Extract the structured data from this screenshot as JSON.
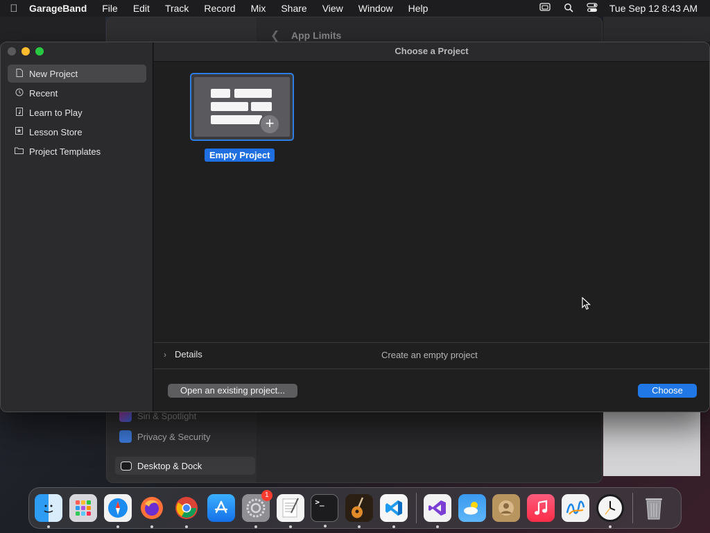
{
  "menubar": {
    "app_name": "GarageBand",
    "menus": [
      "File",
      "Edit",
      "Track",
      "Record",
      "Mix",
      "Share",
      "View",
      "Window",
      "Help"
    ],
    "datetime": "Tue Sep 12  8:43 AM",
    "status_icons": [
      "screen-mirroring-icon",
      "spotlight-search-icon",
      "control-center-icon"
    ]
  },
  "background_window": {
    "title": "App Limits",
    "sidebar_items": [
      "Siri & Spotlight",
      "Privacy & Security",
      "Desktop & Dock"
    ]
  },
  "dialog": {
    "title": "Choose a Project",
    "sidebar": [
      {
        "label": "New Project",
        "icon": "document-icon",
        "selected": true
      },
      {
        "label": "Recent",
        "icon": "clock-icon",
        "selected": false
      },
      {
        "label": "Learn to Play",
        "icon": "music-note-icon",
        "selected": false
      },
      {
        "label": "Lesson Store",
        "icon": "star-icon",
        "selected": false
      },
      {
        "label": "Project Templates",
        "icon": "folder-icon",
        "selected": false
      }
    ],
    "project_tile": {
      "label": "Empty Project"
    },
    "details_label": "Details",
    "description": "Create an empty project",
    "open_button": "Open an existing project...",
    "choose_button": "Choose"
  },
  "dock": {
    "apps": [
      {
        "name": "Finder",
        "icon": "finder-icon",
        "color": "#2f9cf4"
      },
      {
        "name": "Launchpad",
        "icon": "launchpad-icon",
        "color": "#c9c9cd"
      },
      {
        "name": "Safari",
        "icon": "safari-icon",
        "color": "#1a8cf0"
      },
      {
        "name": "Firefox",
        "icon": "firefox-icon",
        "color": "#ff7139"
      },
      {
        "name": "Chrome",
        "icon": "chrome-icon",
        "color": "#ffffff"
      },
      {
        "name": "App Store",
        "icon": "app-store-icon",
        "color": "#1b8cf5"
      },
      {
        "name": "System Settings",
        "icon": "system-settings-icon",
        "color": "#8e8e93",
        "badge": "1"
      },
      {
        "name": "TextEdit",
        "icon": "textedit-icon",
        "color": "#f4f4f4"
      },
      {
        "name": "Terminal",
        "icon": "terminal-icon",
        "color": "#1c1c1e"
      },
      {
        "name": "GarageBand",
        "icon": "garageband-icon",
        "color": "#3a2a1a"
      },
      {
        "name": "Visual Studio Code",
        "icon": "vscode-icon",
        "color": "#f6f6f6"
      },
      {
        "name": "Visual Studio",
        "icon": "visual-studio-icon",
        "color": "#f2f2f2"
      },
      {
        "name": "Weather",
        "icon": "weather-icon",
        "color": "#3a9af0"
      },
      {
        "name": "Contacts",
        "icon": "contacts-icon",
        "color": "#b8945e"
      },
      {
        "name": "Music",
        "icon": "music-icon",
        "color": "#fb3c56"
      },
      {
        "name": "Freeform",
        "icon": "freeform-icon",
        "color": "#f3f3f3"
      },
      {
        "name": "Clock",
        "icon": "clock-app-icon",
        "color": "#f5f5f5"
      },
      {
        "name": "Trash",
        "icon": "trash-icon",
        "color": "#8f8f93"
      }
    ]
  }
}
